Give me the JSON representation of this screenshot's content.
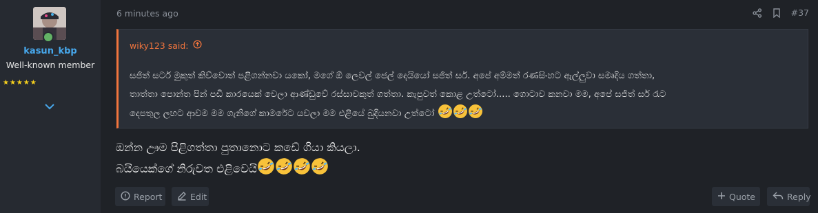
{
  "user": {
    "username": "kasun_kbp",
    "title": "Well-known member",
    "stars": "★★★★★"
  },
  "post": {
    "time": "6 minutes ago",
    "number": "#37",
    "quote": {
      "author": "wiky123 said:",
      "lines": [
        "සජිත් සර්ට මුකුත් කිව්වොත් පළිගන්නවා යකෝ, මගේ ඕ ලෙවල් ජෙල් දෙයියෝ සජිත් සර්. අපේ අම්මත් රණසිංහට ඇල්ලුවා සමෘදිය ගත්තා,",
        "තාත්තා පොන්ත පින් පඩි කාරයෙක් වෙලා ආණ්ඩුවේ රස්සාවකුත් ගත්තා. කැපුවත් කොළ උත්ටෝ..... ගොටාව කනවා මම, අපේ සජිත් සර් රැට",
        "දෙපතුල ලහට ආවම මම ගැනිගේ කාමරේට යවලා මම එළියේ බුදියනවා උත්ටෝ"
      ]
    },
    "message": {
      "line1": "ඔන්න ඌම පිළිගත්තා පුතානොට කඩේ ගියා කියලා.",
      "line2": "බයියෙක්ගේ නිරුවත එළිවෙයි"
    }
  },
  "actions": {
    "report": "Report",
    "edit": "Edit",
    "quote": "Quote",
    "reply": "Reply"
  },
  "colors": {
    "background": "#1f2227",
    "user_panel": "#262a31",
    "accent_orange": "#f2753d",
    "username_blue": "#47a7eb",
    "star_yellow": "#f7d11e"
  },
  "icons": [
    "share-icon",
    "bookmark-icon",
    "arrow-up-circle-icon",
    "chevron-down-icon",
    "report-icon",
    "edit-icon",
    "plus-icon",
    "reply-icon",
    "rofl-emoji"
  ]
}
